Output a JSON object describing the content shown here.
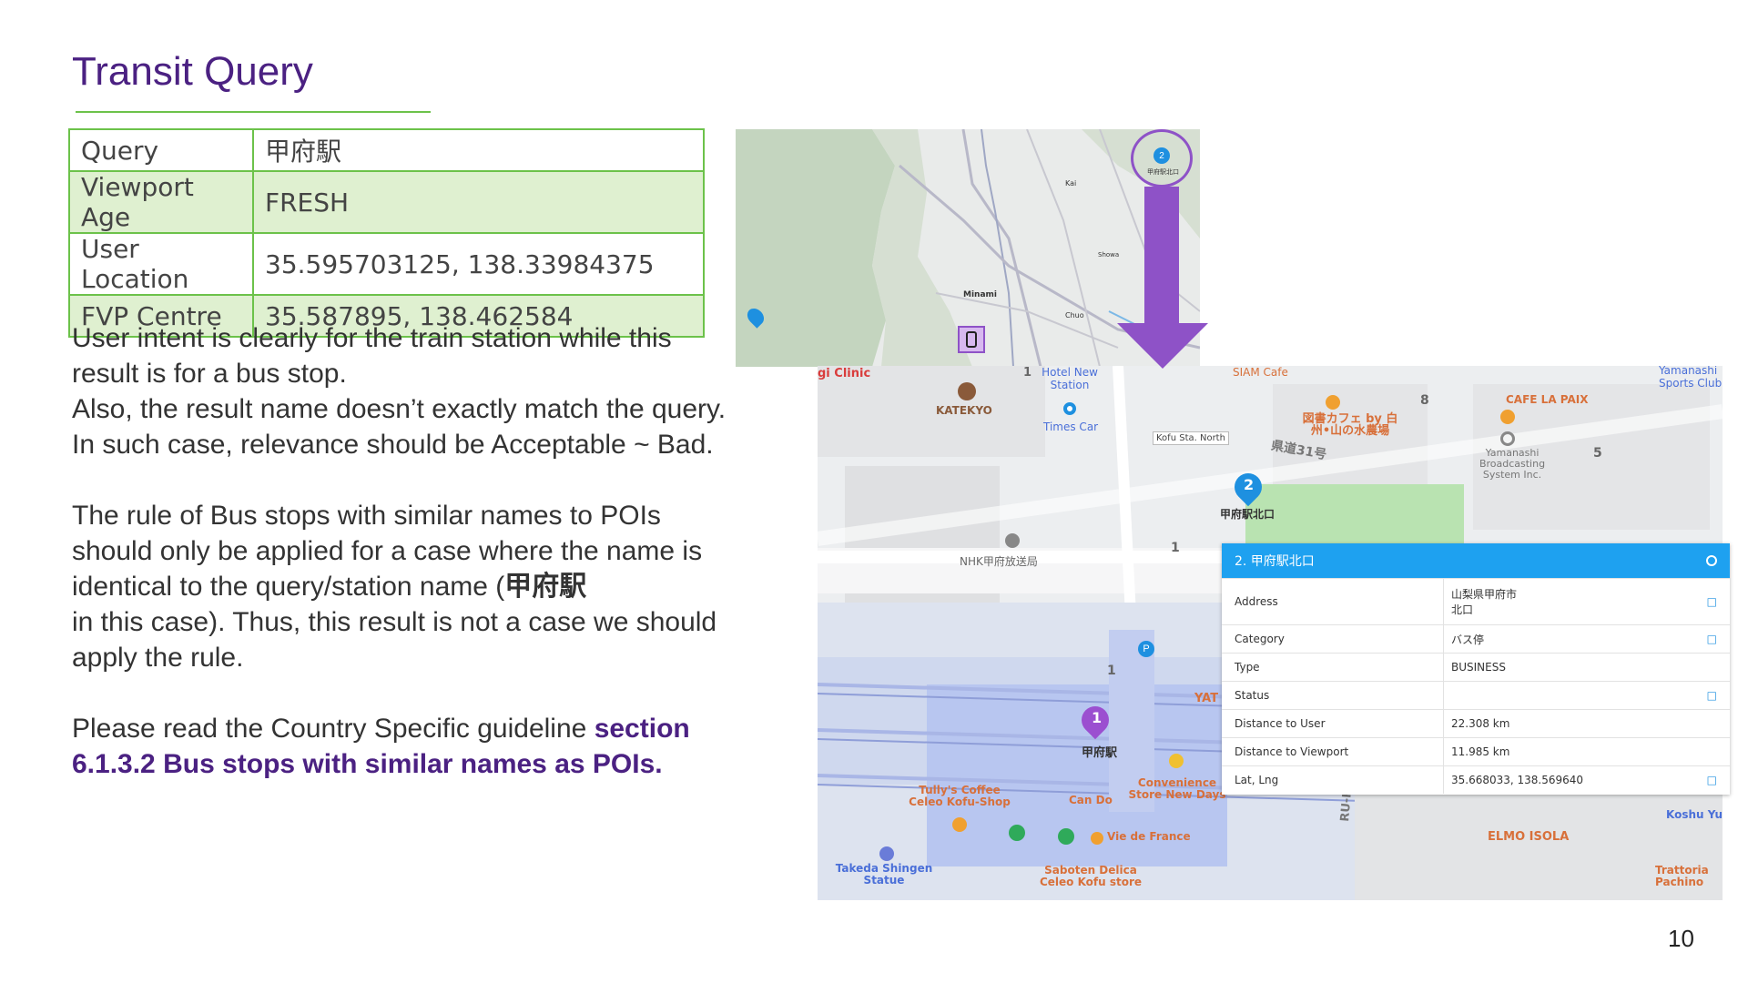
{
  "slide": {
    "title": "Transit Query",
    "page_number": "10"
  },
  "query_table": [
    {
      "key": "Query",
      "value": "甲府駅"
    },
    {
      "key": "Viewport Age",
      "value": "FRESH"
    },
    {
      "key": "User Location",
      "value": "35.595703125, 138.33984375"
    },
    {
      "key": "FVP Centre",
      "value": "35.587895, 138.462584"
    }
  ],
  "body": {
    "p1": "User intent is clearly for the train station while this result is for a bus stop.",
    "p2": "Also, the result name doesn’t exactly match the query. In such case,  relevance should be Acceptable ~ Bad.",
    "p3a": "The rule of Bus stops with similar names to POIs should only be applied for a case where the name is identical to the query/station name (",
    "p3_bold": "甲府駅",
    "p3b": " in this case). Thus, this result is not a case we should apply the rule.",
    "p4a": "Please read the Country Specific guideline ",
    "p4_link": "section 6.1.3.2 Bus stops with similar names as POIs."
  },
  "mini_map": {
    "labels": {
      "minami": "Minami",
      "kai": "Kai",
      "chuo": "Chuo",
      "shows": "Showa",
      "pin": "2",
      "pin_label": "甲府駅北口"
    },
    "colors": {
      "circle": "#8e52c7",
      "arrow": "#8e52c7",
      "terrain": "#c4d5bf"
    }
  },
  "big_map": {
    "labels": {
      "clinic": "gi Clinic",
      "hotel": "Hotel New Station",
      "siam": "SIAM Cafe",
      "yamanashi_sports": "Yamanashi Sports Club",
      "katekyo": "KATEKYO",
      "times": "Times Car",
      "kofu_north": "Kofu Sta. North",
      "library": "図書カフェ by 白州•山の水農場",
      "cafe_la_paix": "CAFE LA PAIX",
      "broadcasting": "Yamanashi Broadcasting System Inc.",
      "kendo": "県道31号",
      "pin2_label": "甲府駅北口",
      "nhk": "NHK甲府放送局",
      "yat": "YAT",
      "kofu_station": "甲府駅",
      "tullys": "Tully's Coffee Celeo Kofu-Shop",
      "can_do": "Can Do",
      "convenience": "Convenience Store New Days",
      "vie": "Vie de France",
      "saboten": "Saboten Delica Celeo Kofu store",
      "takeda": "Takeda Shingen Statue",
      "rikkyo": "RU-RIKKYO BR",
      "elmo": "ELMO ISOLA",
      "koshu": "Koshu Yun",
      "trattoria": "Trattoria Pachino",
      "n1": "1",
      "n8": "8",
      "n5": "5",
      "pin1": "1",
      "pin2": "2"
    }
  },
  "info_panel": {
    "title": "2. 甲府駅北口",
    "rows": [
      {
        "key": "Address",
        "value": "山梨県甲府市",
        "value2": "北口",
        "copy": true
      },
      {
        "key": "Category",
        "value": "バス停",
        "copy": true
      },
      {
        "key": "Type",
        "value": "BUSINESS",
        "copy": false
      },
      {
        "key": "Status",
        "value": "",
        "copy": true
      },
      {
        "key": "Distance to User",
        "value": "22.308 km",
        "copy": false
      },
      {
        "key": "Distance to Viewport",
        "value": "11.985 km",
        "copy": false
      },
      {
        "key": "Lat, Lng",
        "value": "35.668033, 138.569640",
        "copy": true
      }
    ]
  }
}
